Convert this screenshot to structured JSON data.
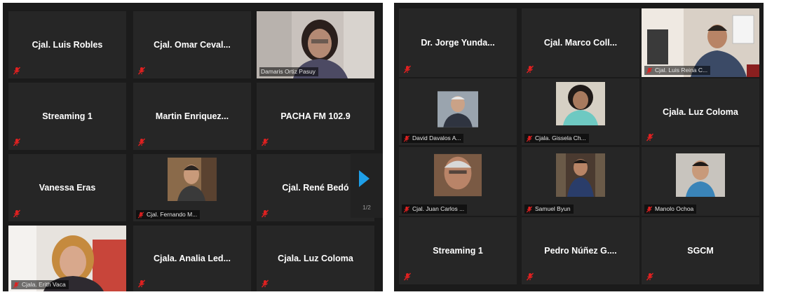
{
  "left_panel": {
    "tiles": [
      {
        "name": "Cjal. Luis Robles"
      },
      {
        "name": "Cjal.  Omar Ceval..."
      },
      {
        "label": "Damaris Ortiz Pasuy"
      },
      {
        "name": "Streaming 1"
      },
      {
        "name": "Martin  Enriquez..."
      },
      {
        "name": "PACHA FM 102.9"
      },
      {
        "name": "Vanessa Eras"
      },
      {
        "label": "Cjal. Fernando M..."
      },
      {
        "name": "Cjal. René Bedó"
      },
      {
        "label": "Cjala. Erith Vaca"
      },
      {
        "name": "Cjala.  Analia  Led..."
      },
      {
        "name": "Cjala. Luz Coloma"
      }
    ],
    "pagination": {
      "page": "1/2"
    }
  },
  "right_panel": {
    "tiles": [
      {
        "name": "Dr.  Jorge  Yunda..."
      },
      {
        "name": "Cjal.  Marco  Coll..."
      },
      {
        "label": "Cjal. Luis Reina C..."
      },
      {
        "label": "David Davalos A..."
      },
      {
        "label": "Cjala. Gissela Ch..."
      },
      {
        "name": "Cjala. Luz Coloma"
      },
      {
        "label": "Cjal. Juan Carlos ..."
      },
      {
        "label": "Samuel Byun"
      },
      {
        "label": "Manolo Ochoa"
      },
      {
        "name": "Streaming 1"
      },
      {
        "name": "Pedro  Núñez  G...."
      },
      {
        "name": "SGCM"
      }
    ]
  },
  "colors": {
    "mic_muted": "#e02020",
    "arrow": "#1e9fe8",
    "tile_bg": "#262626",
    "panel_bg": "#1b1b1b"
  },
  "icons": {
    "mic": "muted-microphone-icon",
    "next": "next-page-arrow-icon"
  }
}
